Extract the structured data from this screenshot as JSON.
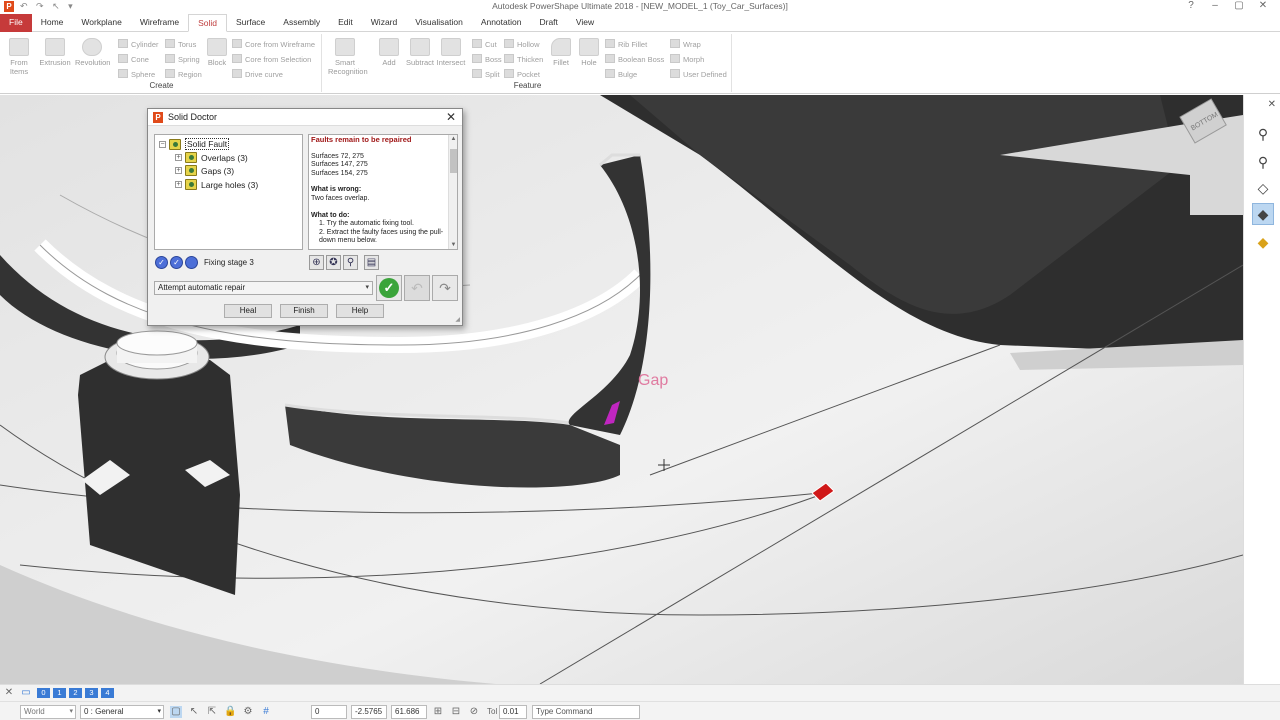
{
  "app": {
    "title": "Autodesk PowerShape Ultimate 2018 - [NEW_MODEL_1 (Toy_Car_Surfaces)]",
    "logo_letter": "P"
  },
  "tabs": [
    "File",
    "Home",
    "Workplane",
    "Wireframe",
    "Solid",
    "Surface",
    "Assembly",
    "Edit",
    "Wizard",
    "Visualisation",
    "Annotation",
    "Draft",
    "View"
  ],
  "active_tab": "Solid",
  "ribbon": {
    "create_group": {
      "label": "Create",
      "big": [
        "From Items",
        "Extrusion",
        "Revolution",
        "Block"
      ],
      "small_col1": [
        "Cylinder",
        "Cone",
        "Sphere"
      ],
      "small_col2": [
        "Torus",
        "Spring",
        "Region"
      ],
      "small_col3": [
        "Core from Wireframe",
        "Core from Selection",
        "Drive curve"
      ]
    },
    "feature_group": {
      "label": "Feature",
      "big": [
        "Smart Recognition",
        "Add",
        "Subtract",
        "Intersect",
        "Fillet",
        "Hole"
      ],
      "small_col1": [
        "Cut",
        "Boss",
        "Split"
      ],
      "small_col2": [
        "Hollow",
        "Thicken",
        "Pocket"
      ],
      "small_col3": [
        "Rib Fillet",
        "Boolean Boss",
        "Bulge"
      ],
      "small_col4": [
        "Wrap",
        "Morph",
        "User Defined"
      ]
    }
  },
  "viewport": {
    "gap_label": "Gap",
    "view_cube_label": "BOTTOM"
  },
  "dialog": {
    "title": "Solid Doctor",
    "tree": {
      "root": "Solid Fault",
      "children": [
        "Overlaps (3)",
        "Gaps (3)",
        "Large holes (3)"
      ]
    },
    "info": {
      "header": "Faults remain to be repaired",
      "surfaces": [
        "Surfaces 72, 275",
        "Surfaces 147, 275",
        "Surfaces 154, 275"
      ],
      "wrong_label": "What is wrong:",
      "wrong_text": "Two faces overlap.",
      "todo_label": "What to do:",
      "todo_1": "1. Try the automatic fixing tool.",
      "todo_2": "2. Extract the faulty faces using the pull-down menu below."
    },
    "stage_label": "Fixing stage 3",
    "repair_option": "Attempt automatic repair",
    "buttons": {
      "heal": "Heal",
      "finish": "Finish",
      "help": "Help"
    }
  },
  "status": {
    "levels": [
      "0",
      "1",
      "2",
      "3",
      "4"
    ],
    "workplane": "World",
    "level_select": "0 : General",
    "coords": {
      "a": "0",
      "x": "-2.5765",
      "y": "61.686"
    },
    "tol_label": "Tol",
    "tol_value": "0.01",
    "command_placeholder": "Type Command"
  }
}
